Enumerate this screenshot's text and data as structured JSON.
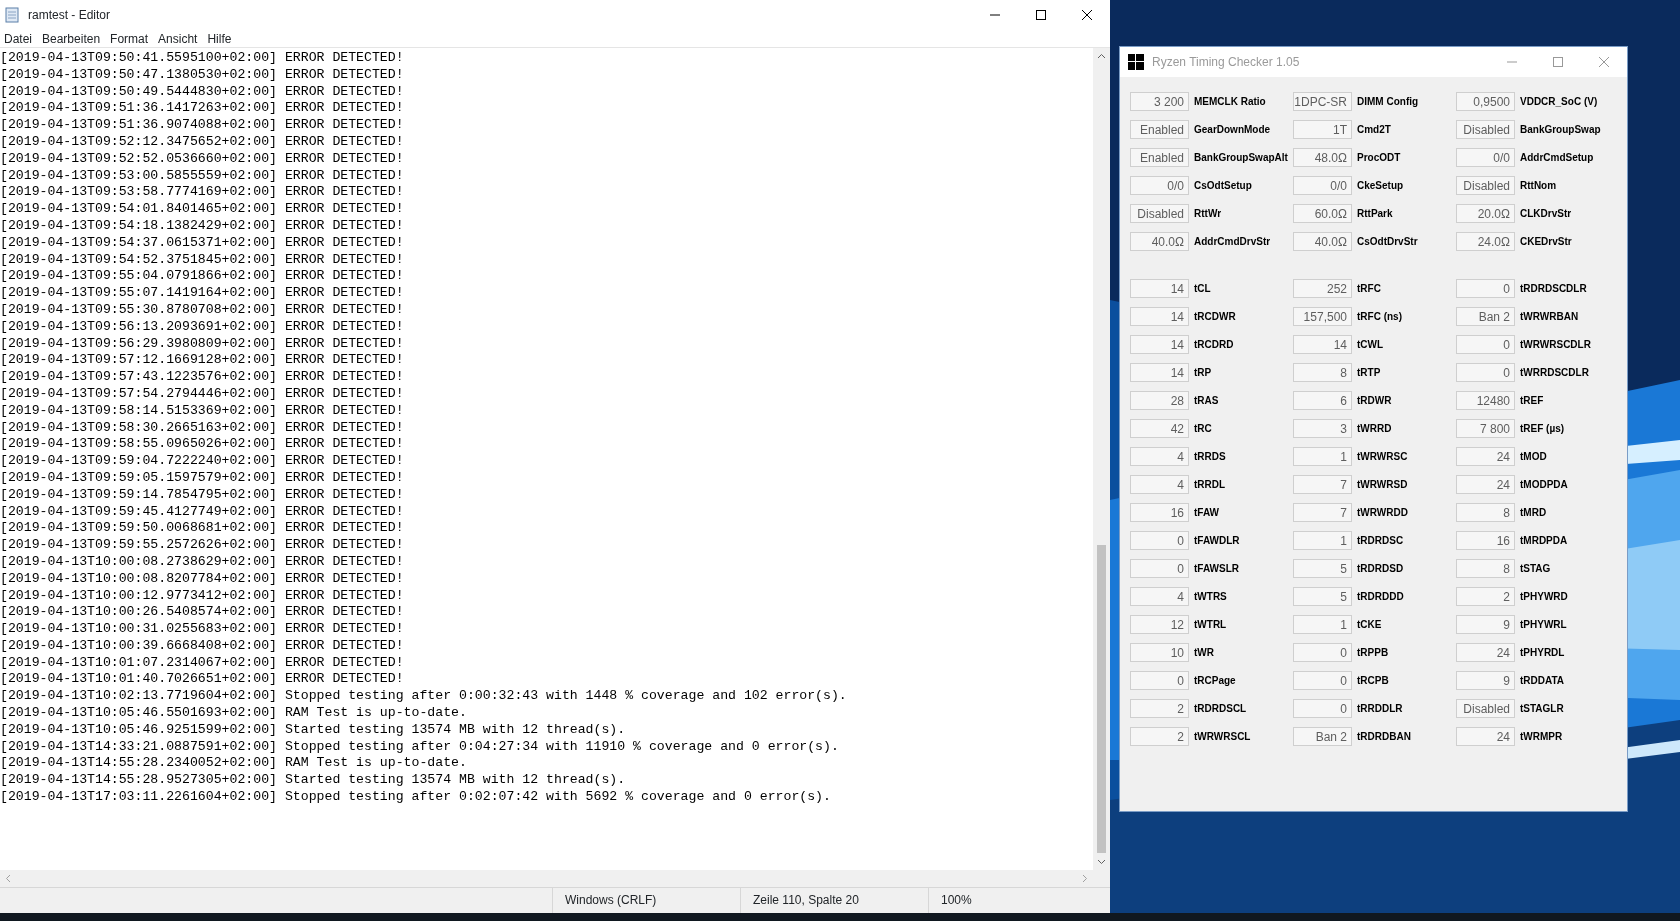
{
  "notepad": {
    "title": "ramtest - Editor",
    "menu": [
      "Datei",
      "Bearbeiten",
      "Format",
      "Ansicht",
      "Hilfe"
    ],
    "lines": [
      "[2019-04-13T09:50:41.5595100+02:00] ERROR DETECTED!",
      "[2019-04-13T09:50:47.1380530+02:00] ERROR DETECTED!",
      "[2019-04-13T09:50:49.5444830+02:00] ERROR DETECTED!",
      "[2019-04-13T09:51:36.1417263+02:00] ERROR DETECTED!",
      "[2019-04-13T09:51:36.9074088+02:00] ERROR DETECTED!",
      "[2019-04-13T09:52:12.3475652+02:00] ERROR DETECTED!",
      "[2019-04-13T09:52:52.0536660+02:00] ERROR DETECTED!",
      "[2019-04-13T09:53:00.5855559+02:00] ERROR DETECTED!",
      "[2019-04-13T09:53:58.7774169+02:00] ERROR DETECTED!",
      "[2019-04-13T09:54:01.8401465+02:00] ERROR DETECTED!",
      "[2019-04-13T09:54:18.1382429+02:00] ERROR DETECTED!",
      "[2019-04-13T09:54:37.0615371+02:00] ERROR DETECTED!",
      "[2019-04-13T09:54:52.3751845+02:00] ERROR DETECTED!",
      "[2019-04-13T09:55:04.0791866+02:00] ERROR DETECTED!",
      "[2019-04-13T09:55:07.1419164+02:00] ERROR DETECTED!",
      "[2019-04-13T09:55:30.8780708+02:00] ERROR DETECTED!",
      "[2019-04-13T09:56:13.2093691+02:00] ERROR DETECTED!",
      "[2019-04-13T09:56:29.3980809+02:00] ERROR DETECTED!",
      "[2019-04-13T09:57:12.1669128+02:00] ERROR DETECTED!",
      "[2019-04-13T09:57:43.1223576+02:00] ERROR DETECTED!",
      "[2019-04-13T09:57:54.2794446+02:00] ERROR DETECTED!",
      "[2019-04-13T09:58:14.5153369+02:00] ERROR DETECTED!",
      "[2019-04-13T09:58:30.2665163+02:00] ERROR DETECTED!",
      "[2019-04-13T09:58:55.0965026+02:00] ERROR DETECTED!",
      "[2019-04-13T09:59:04.7222240+02:00] ERROR DETECTED!",
      "[2019-04-13T09:59:05.1597579+02:00] ERROR DETECTED!",
      "[2019-04-13T09:59:14.7854795+02:00] ERROR DETECTED!",
      "[2019-04-13T09:59:45.4127749+02:00] ERROR DETECTED!",
      "[2019-04-13T09:59:50.0068681+02:00] ERROR DETECTED!",
      "[2019-04-13T09:59:55.2572626+02:00] ERROR DETECTED!",
      "[2019-04-13T10:00:08.2738629+02:00] ERROR DETECTED!",
      "[2019-04-13T10:00:08.8207784+02:00] ERROR DETECTED!",
      "[2019-04-13T10:00:12.9773412+02:00] ERROR DETECTED!",
      "[2019-04-13T10:00:26.5408574+02:00] ERROR DETECTED!",
      "[2019-04-13T10:00:31.0255683+02:00] ERROR DETECTED!",
      "[2019-04-13T10:00:39.6668408+02:00] ERROR DETECTED!",
      "[2019-04-13T10:01:07.2314067+02:00] ERROR DETECTED!",
      "[2019-04-13T10:01:40.7026651+02:00] ERROR DETECTED!",
      "[2019-04-13T10:02:13.7719604+02:00] Stopped testing after 0:00:32:43 with 1448 % coverage and 102 error(s).",
      "[2019-04-13T10:05:46.5501693+02:00] RAM Test is up-to-date.",
      "[2019-04-13T10:05:46.9251599+02:00] Started testing 13574 MB with 12 thread(s).",
      "[2019-04-13T14:33:21.0887591+02:00] Stopped testing after 0:04:27:34 with 11910 % coverage and 0 error(s).",
      "[2019-04-13T14:55:28.2340052+02:00] RAM Test is up-to-date.",
      "[2019-04-13T14:55:28.9527305+02:00] Started testing 13574 MB with 12 thread(s).",
      "[2019-04-13T17:03:11.2261604+02:00] Stopped testing after 0:02:07:42 with 5692 % coverage and 0 error(s)."
    ],
    "status_bar": {
      "line_endings": "Windows (CRLF)",
      "position": "Zeile 110, Spalte 20",
      "zoom": "100%"
    }
  },
  "checker": {
    "title": "Ryzen Timing Checker 1.05",
    "groups": [
      [
        {
          "value": "3 200",
          "label": "MEMCLK Ratio"
        },
        {
          "value": "1DPC-SR",
          "label": "DIMM Config"
        },
        {
          "value": "0,9500",
          "label": "VDDCR_SoC (V)"
        },
        {
          "value": "Enabled",
          "label": "GearDownMode"
        },
        {
          "value": "1T",
          "label": "Cmd2T"
        },
        {
          "value": "Disabled",
          "label": "BankGroupSwap"
        },
        {
          "value": "Enabled",
          "label": "BankGroupSwapAlt"
        },
        {
          "value": "48.0Ω",
          "label": "ProcODT"
        },
        {
          "value": "0/0",
          "label": "AddrCmdSetup"
        },
        {
          "value": "0/0",
          "label": "CsOdtSetup"
        },
        {
          "value": "0/0",
          "label": "CkeSetup"
        },
        {
          "value": "Disabled",
          "label": "RttNom"
        },
        {
          "value": "Disabled",
          "label": "RttWr"
        },
        {
          "value": "60.0Ω",
          "label": "RttPark"
        },
        {
          "value": "20.0Ω",
          "label": "CLKDrvStr"
        },
        {
          "value": "40.0Ω",
          "label": "AddrCmdDrvStr"
        },
        {
          "value": "40.0Ω",
          "label": "CsOdtDrvStr"
        },
        {
          "value": "24.0Ω",
          "label": "CKEDrvStr"
        }
      ],
      [
        {
          "value": "14",
          "label": "tCL"
        },
        {
          "value": "252",
          "label": "tRFC"
        },
        {
          "value": "0",
          "label": "tRDRDSCDLR"
        },
        {
          "value": "14",
          "label": "tRCDWR"
        },
        {
          "value": "157,500",
          "label": "tRFC (ns)"
        },
        {
          "value": "Ban 2",
          "label": "tWRWRBAN"
        },
        {
          "value": "14",
          "label": "tRCDRD"
        },
        {
          "value": "14",
          "label": "tCWL"
        },
        {
          "value": "0",
          "label": "tWRWRSCDLR"
        },
        {
          "value": "14",
          "label": "tRP"
        },
        {
          "value": "8",
          "label": "tRTP"
        },
        {
          "value": "0",
          "label": "tWRRDSCDLR"
        },
        {
          "value": "28",
          "label": "tRAS"
        },
        {
          "value": "6",
          "label": "tRDWR"
        },
        {
          "value": "12480",
          "label": "tREF"
        },
        {
          "value": "42",
          "label": "tRC"
        },
        {
          "value": "3",
          "label": "tWRRD"
        },
        {
          "value": "7 800",
          "label": "tREF (µs)"
        },
        {
          "value": "4",
          "label": "tRRDS"
        },
        {
          "value": "1",
          "label": "tWRWRSC"
        },
        {
          "value": "24",
          "label": "tMOD"
        },
        {
          "value": "4",
          "label": "tRRDL"
        },
        {
          "value": "7",
          "label": "tWRWRSD"
        },
        {
          "value": "24",
          "label": "tMODPDA"
        },
        {
          "value": "16",
          "label": "tFAW"
        },
        {
          "value": "7",
          "label": "tWRWRDD"
        },
        {
          "value": "8",
          "label": "tMRD"
        },
        {
          "value": "0",
          "label": "tFAWDLR"
        },
        {
          "value": "1",
          "label": "tRDRDSC"
        },
        {
          "value": "16",
          "label": "tMRDPDA"
        },
        {
          "value": "0",
          "label": "tFAWSLR"
        },
        {
          "value": "5",
          "label": "tRDRDSD"
        },
        {
          "value": "8",
          "label": "tSTAG"
        },
        {
          "value": "4",
          "label": "tWTRS"
        },
        {
          "value": "5",
          "label": "tRDRDDD"
        },
        {
          "value": "2",
          "label": "tPHYWRD"
        },
        {
          "value": "12",
          "label": "tWTRL"
        },
        {
          "value": "1",
          "label": "tCKE"
        },
        {
          "value": "9",
          "label": "tPHYWRL"
        },
        {
          "value": "10",
          "label": "tWR"
        },
        {
          "value": "0",
          "label": "tRPPB"
        },
        {
          "value": "24",
          "label": "tPHYRDL"
        },
        {
          "value": "0",
          "label": "tRCPage"
        },
        {
          "value": "0",
          "label": "tRCPB"
        },
        {
          "value": "9",
          "label": "tRDDATA"
        },
        {
          "value": "2",
          "label": "tRDRDSCL"
        },
        {
          "value": "0",
          "label": "tRRDDLR"
        },
        {
          "value": "Disabled",
          "label": "tSTAGLR"
        },
        {
          "value": "2",
          "label": "tWRWRSCL"
        },
        {
          "value": "Ban 2",
          "label": "tRDRDBAN"
        },
        {
          "value": "24",
          "label": "tWRMPR"
        }
      ]
    ]
  }
}
